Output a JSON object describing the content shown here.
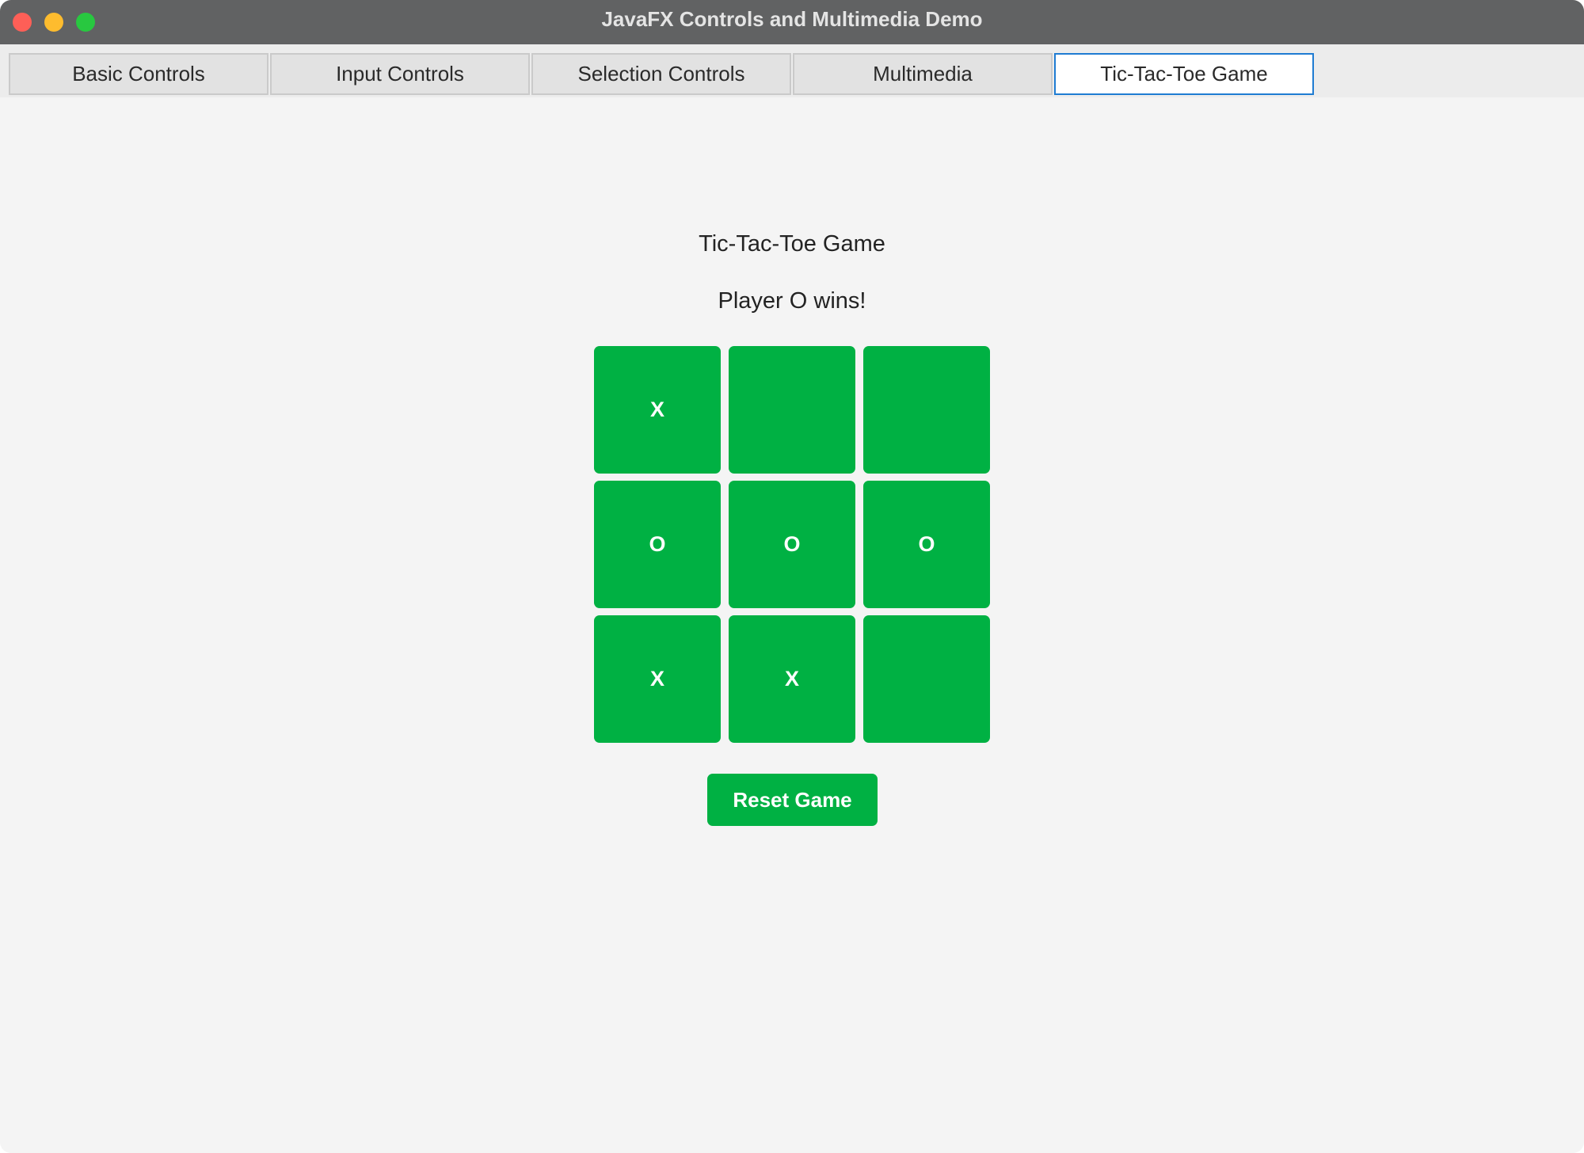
{
  "window": {
    "title": "JavaFX Controls and Multimedia Demo"
  },
  "tabs": [
    {
      "label": "Basic Controls",
      "selected": false
    },
    {
      "label": "Input Controls",
      "selected": false
    },
    {
      "label": "Selection Controls",
      "selected": false
    },
    {
      "label": "Multimedia",
      "selected": false
    },
    {
      "label": "Tic-Tac-Toe Game",
      "selected": true
    }
  ],
  "game": {
    "title": "Tic-Tac-Toe Game",
    "status": "Player O wins!",
    "board": [
      "X",
      "",
      "",
      "O",
      "O",
      "O",
      "X",
      "X",
      ""
    ],
    "reset_label": "Reset Game"
  },
  "colors": {
    "accent_green": "#00b143",
    "tab_focus_border": "#1f7cd2",
    "titlebar": "#616263"
  }
}
